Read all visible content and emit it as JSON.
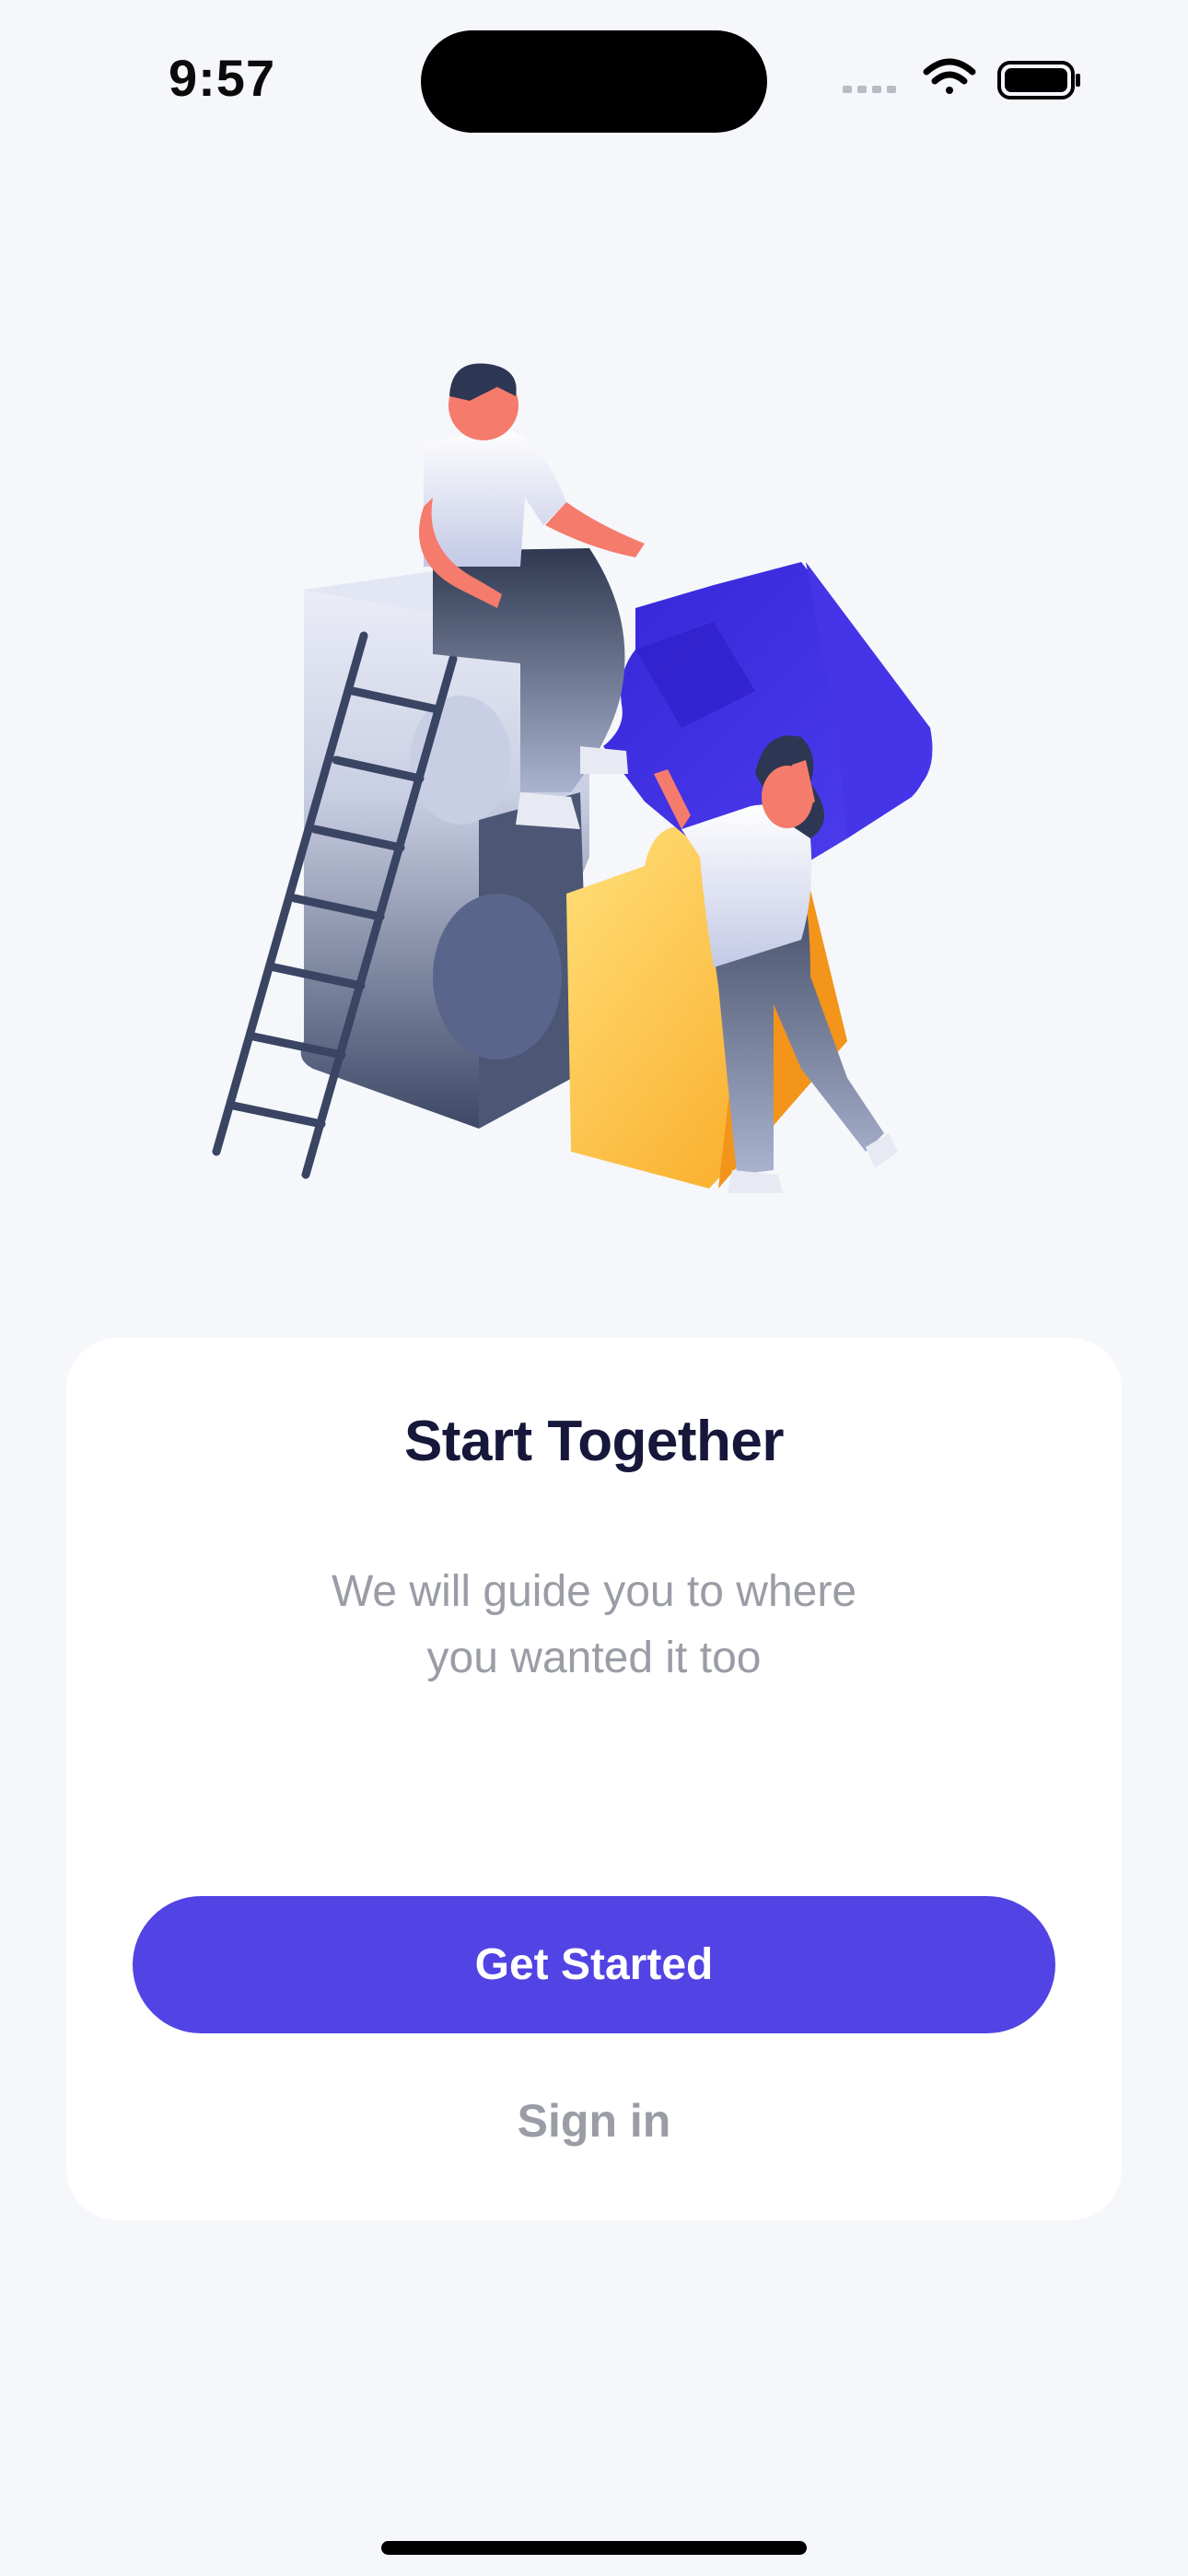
{
  "status_bar": {
    "time": "9:57",
    "icons": [
      "cellular-signal-icon",
      "wifi-icon",
      "battery-icon"
    ]
  },
  "illustration": {
    "name": "team-puzzle-illustration",
    "colors": {
      "purple": "#3c2bdc",
      "yellow": "#fdc84a",
      "slate": "#5b6887"
    }
  },
  "onboarding": {
    "title": "Start Together",
    "subtitle_line1": "We will guide you to where",
    "subtitle_line2": "you wanted it too",
    "primary_button": "Get Started",
    "secondary_button": "Sign in"
  },
  "colors": {
    "background": "#f5f7fb",
    "card": "#ffffff",
    "accent": "#5243e4",
    "title_text": "#16173a",
    "muted_text": "#9a9ca6"
  }
}
